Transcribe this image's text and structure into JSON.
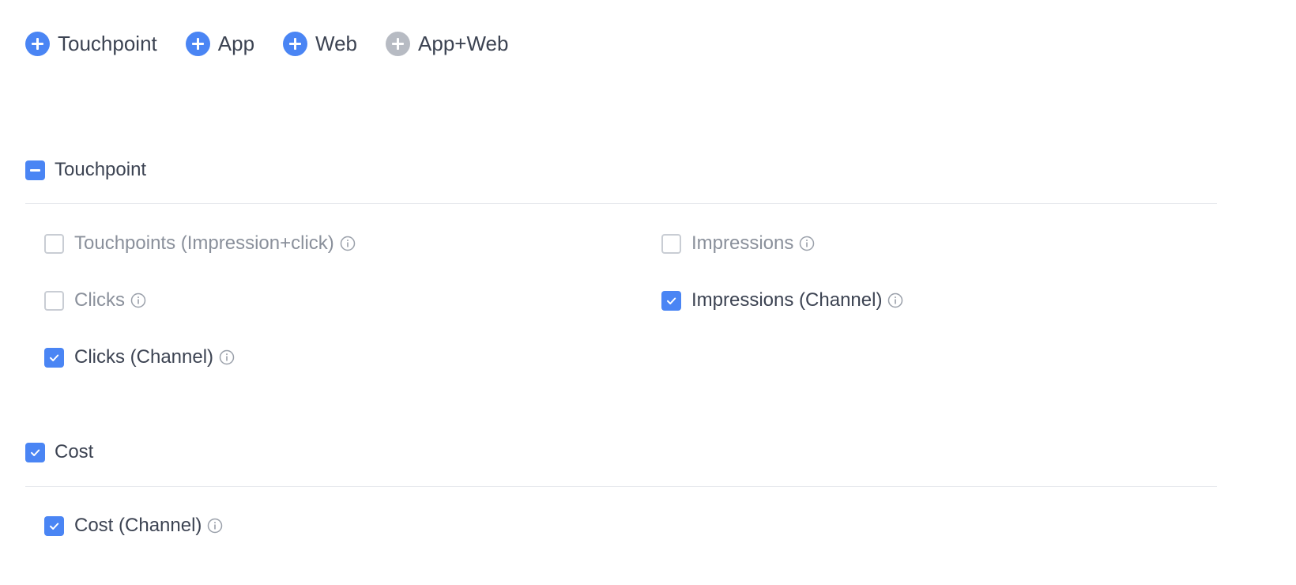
{
  "add_bar": {
    "items": [
      {
        "label": "Touchpoint",
        "color": "#4a85f4"
      },
      {
        "label": "App",
        "color": "#4a85f4"
      },
      {
        "label": "Web",
        "color": "#4a85f4"
      },
      {
        "label": "App+Web",
        "color": "#b7bbc3"
      }
    ]
  },
  "sections": {
    "touchpoint": {
      "title": "Touchpoint",
      "state": "partial",
      "options": {
        "touchpoints_impression_click": {
          "label": "Touchpoints (Impression+click)",
          "checked": false
        },
        "impressions": {
          "label": "Impressions",
          "checked": false
        },
        "clicks": {
          "label": "Clicks",
          "checked": false
        },
        "impressions_channel": {
          "label": "Impressions (Channel)",
          "checked": true
        },
        "clicks_channel": {
          "label": "Clicks (Channel)",
          "checked": true
        }
      }
    },
    "cost": {
      "title": "Cost",
      "state": "checked",
      "options": {
        "cost_channel": {
          "label": "Cost (Channel)",
          "checked": true
        }
      }
    }
  },
  "colors": {
    "accent": "#4a85f4",
    "disabled": "#b7bbc3",
    "text": "#3c4352",
    "muted_text": "#8a909b"
  },
  "icons": {
    "add": "plus-circle-icon",
    "info": "info-circle-icon",
    "check": "check-icon",
    "partial": "minus-icon"
  }
}
